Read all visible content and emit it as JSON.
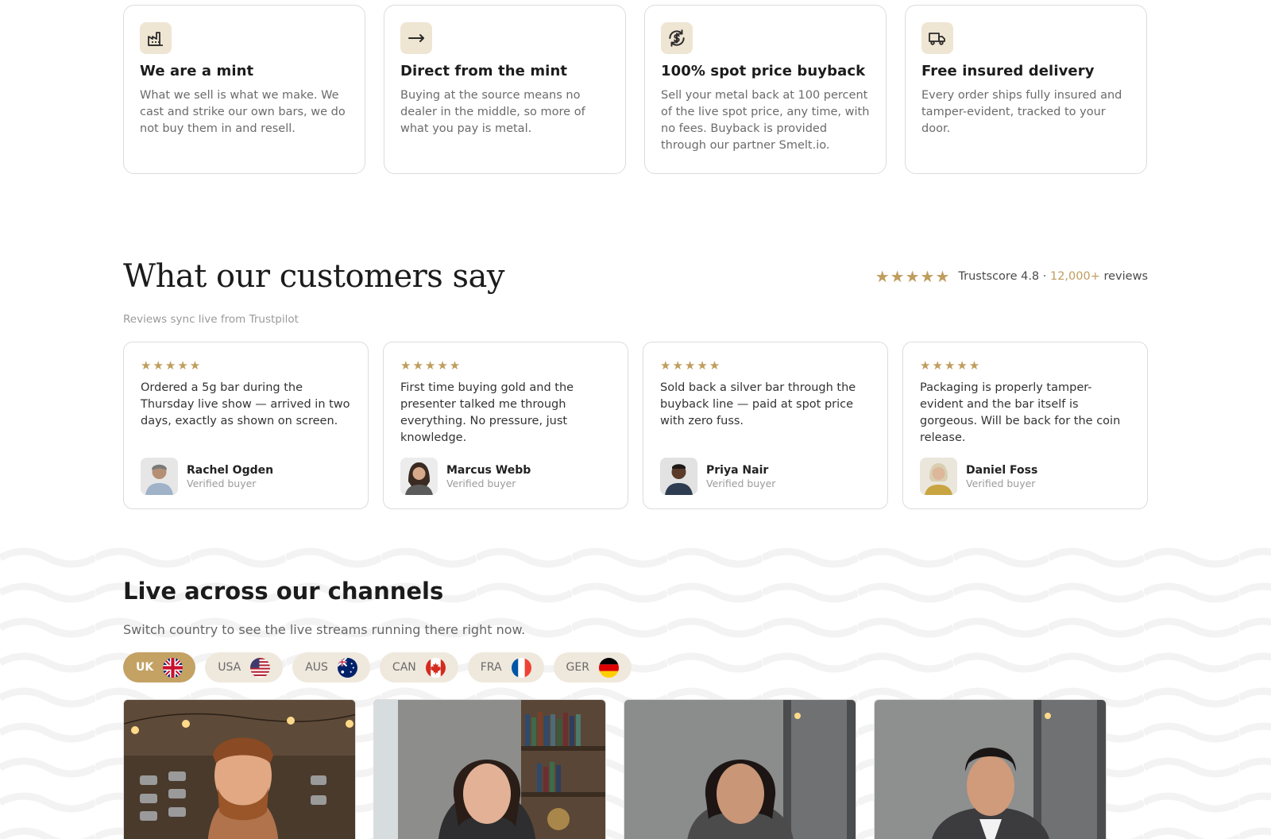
{
  "features": [
    {
      "icon": "factory-icon",
      "title": "We are a mint",
      "text": "What we sell is what we make. We cast and strike our own bars, we do not buy them in and resell."
    },
    {
      "icon": "arrow-right-icon",
      "title": "Direct from the mint",
      "text": "Buying at the source means no dealer in the middle, so more of what you pay is metal."
    },
    {
      "icon": "dollar-exchange-icon",
      "title": "100% spot price buyback",
      "text": "Sell your metal back at 100 percent of the live spot price, any time, with no fees. Buyback is provided through our partner Smelt.io."
    },
    {
      "icon": "truck-icon",
      "title": "Free insured delivery",
      "text": "Every order ships fully insured and tamper-evident, tracked to your door."
    }
  ],
  "reviews_section": {
    "title": "What our customers say",
    "stars": "★★★★★",
    "trust_label": "Trustscore 4.8 ·",
    "count": "12,000+",
    "count_suffix": "reviews",
    "subtitle": "Reviews sync live from Trustpilot",
    "items": [
      {
        "stars": "★★★★★",
        "text": "Ordered a 5g bar during the Thursday live show — arrived in two days, exactly as shown on screen.",
        "name": "Rachel Ogden",
        "role": "Verified buyer"
      },
      {
        "stars": "★★★★★",
        "text": "First time buying gold and the presenter talked me through everything. No pressure, just knowledge.",
        "name": "Marcus Webb",
        "role": "Verified buyer"
      },
      {
        "stars": "★★★★★",
        "text": "Sold back a silver bar through the buyback line — paid at spot price with zero fuss.",
        "name": "Priya Nair",
        "role": "Verified buyer"
      },
      {
        "stars": "★★★★★",
        "text": "Packaging is properly tamper-evident and the bar itself is gorgeous. Will be back for the coin release.",
        "name": "Daniel Foss",
        "role": "Verified buyer"
      }
    ]
  },
  "channels": {
    "title": "Live across our channels",
    "subtitle": "Switch country to see the live streams running there right now.",
    "countries": [
      {
        "code": "UK",
        "active": true
      },
      {
        "code": "USA",
        "active": false
      },
      {
        "code": "AUS",
        "active": false
      },
      {
        "code": "CAN",
        "active": false
      },
      {
        "code": "FRA",
        "active": false
      },
      {
        "code": "GER",
        "active": false
      }
    ]
  },
  "colors": {
    "accent": "#c4a264",
    "accent_light": "#efe8dc",
    "icon_bg": "#efe5d3",
    "star": "#bf9d5d"
  }
}
